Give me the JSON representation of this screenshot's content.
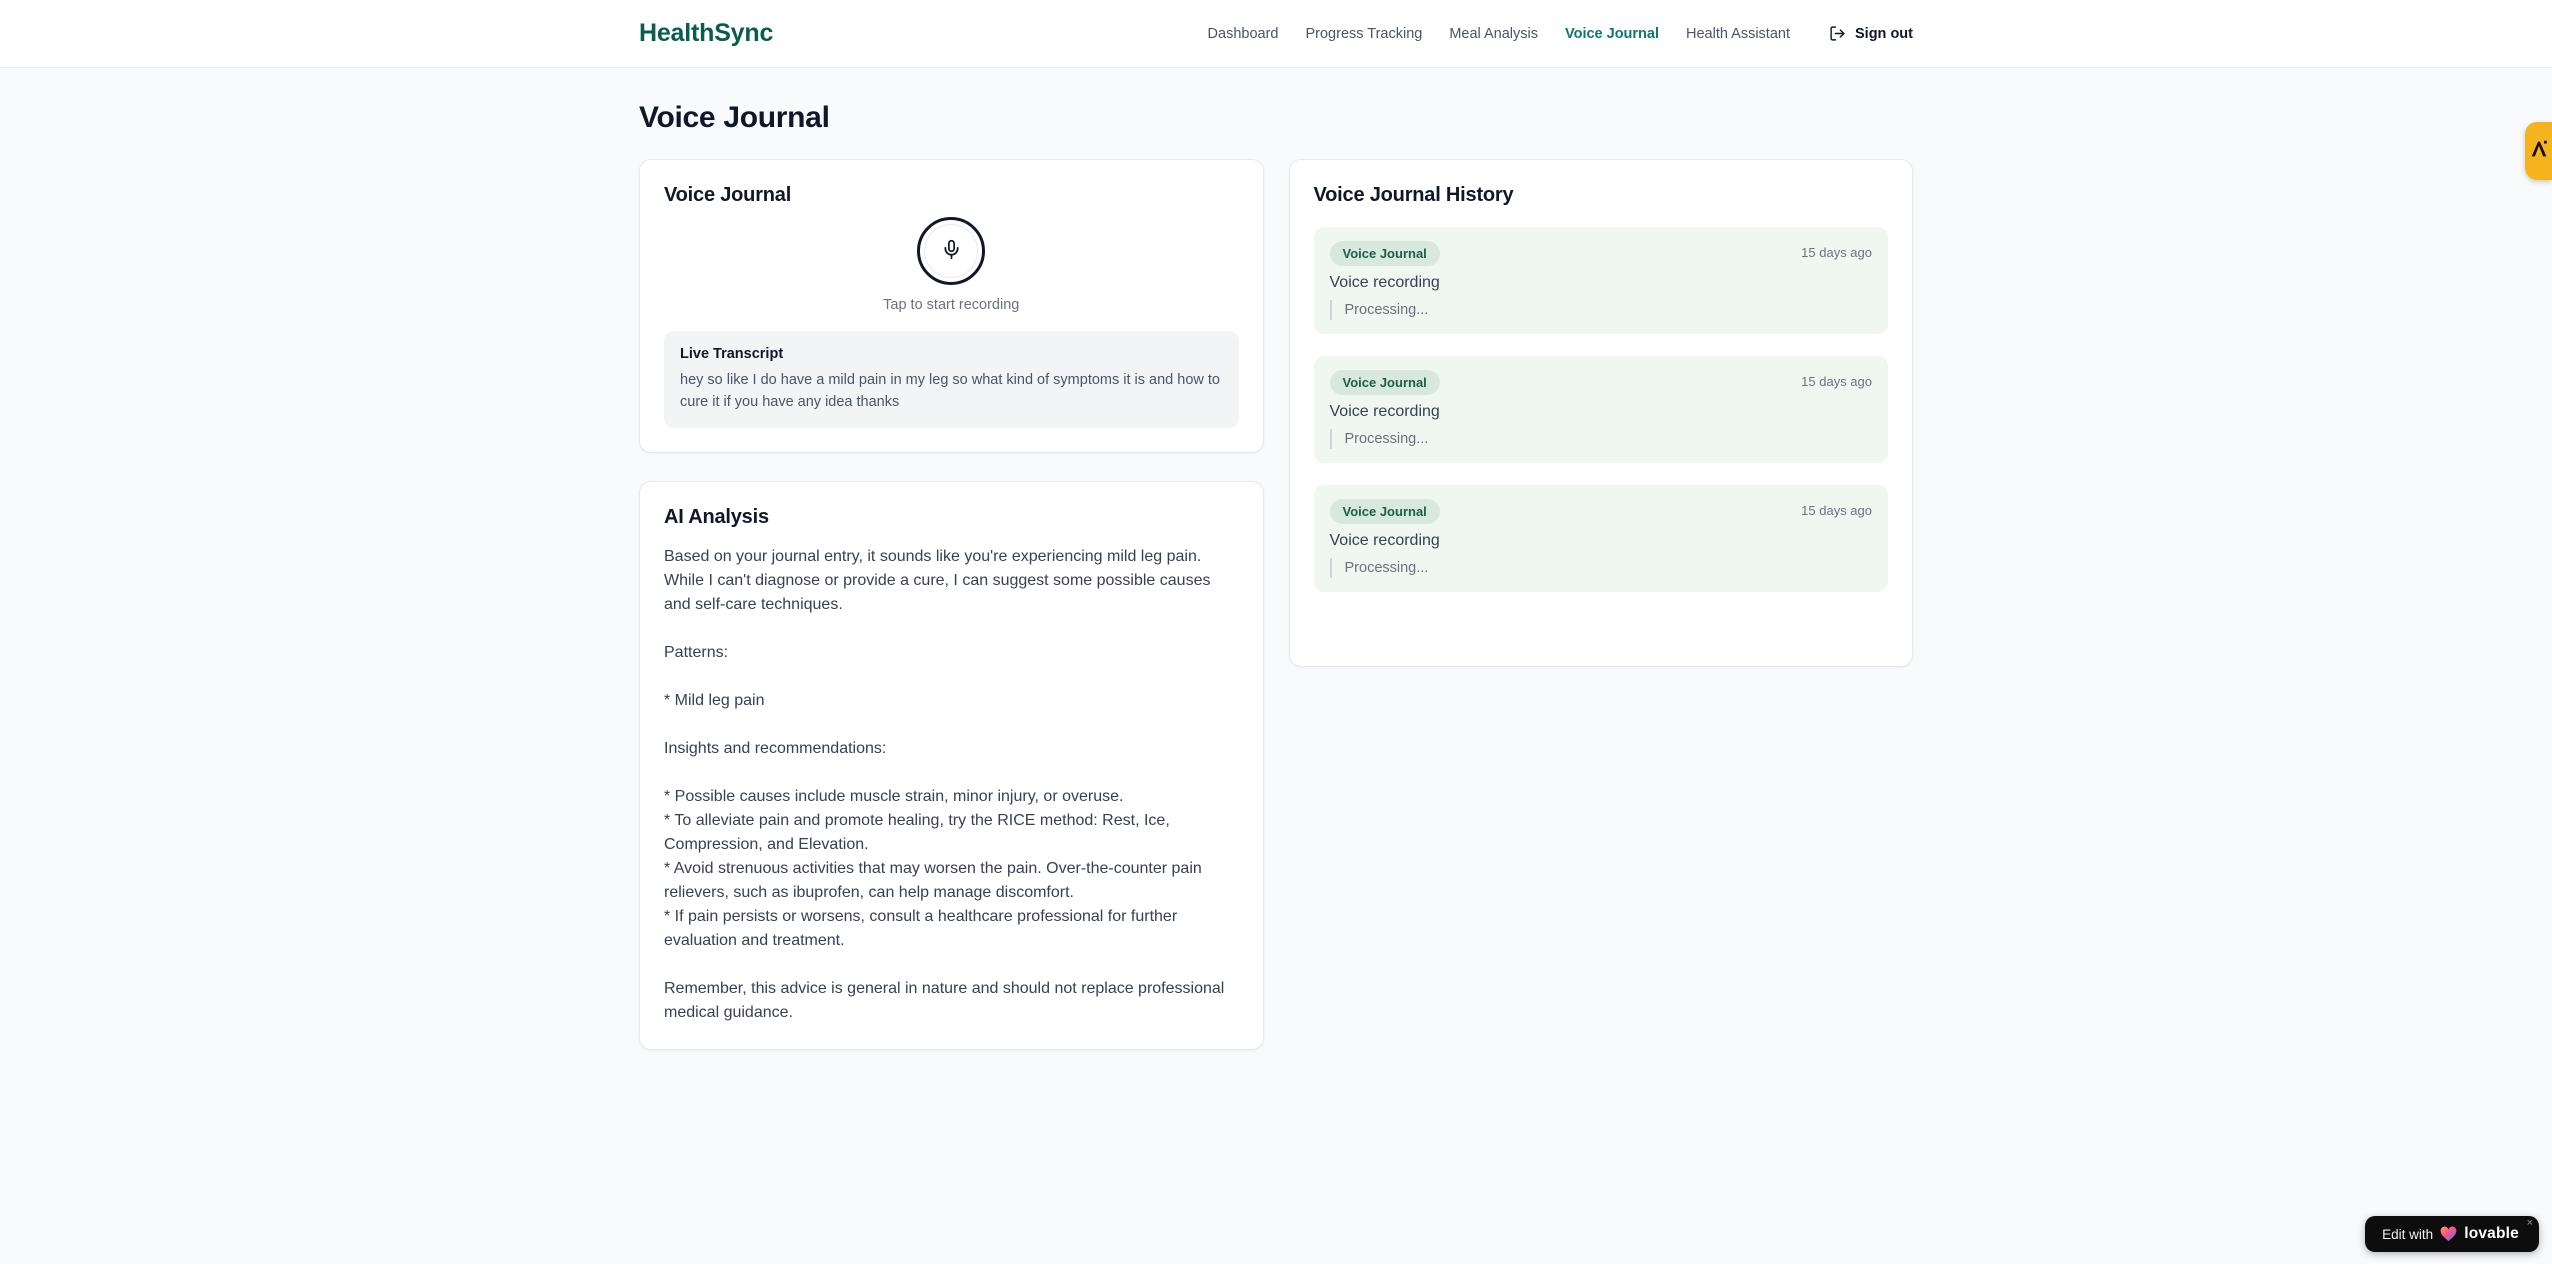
{
  "header": {
    "logo": "HealthSync",
    "nav": [
      {
        "label": "Dashboard",
        "active": false
      },
      {
        "label": "Progress Tracking",
        "active": false
      },
      {
        "label": "Meal Analysis",
        "active": false
      },
      {
        "label": "Voice Journal",
        "active": true
      },
      {
        "label": "Health Assistant",
        "active": false
      }
    ],
    "sign_out_label": "Sign out"
  },
  "page": {
    "title": "Voice Journal"
  },
  "recorder_card": {
    "title": "Voice Journal",
    "tap_hint": "Tap to start recording",
    "live_transcript": {
      "title": "Live Transcript",
      "text": "hey so like I do have a mild pain in my leg so what kind of symptoms it is and how to cure it if you have any idea thanks"
    }
  },
  "ai_analysis_card": {
    "title": "AI Analysis",
    "body": "Based on your journal entry, it sounds like you're experiencing mild leg pain. While I can't diagnose or provide a cure, I can suggest some possible causes and self-care techniques.\n\nPatterns:\n\n* Mild leg pain\n\nInsights and recommendations:\n\n* Possible causes include muscle strain, minor injury, or overuse.\n* To alleviate pain and promote healing, try the RICE method: Rest, Ice, Compression, and Elevation.\n* Avoid strenuous activities that may worsen the pain. Over-the-counter pain relievers, such as ibuprofen, can help manage discomfort.\n* If pain persists or worsens, consult a healthcare professional for further evaluation and treatment.\n\nRemember, this advice is general in nature and should not replace professional medical guidance."
  },
  "history_card": {
    "title": "Voice Journal History",
    "entries": [
      {
        "badge": "Voice Journal",
        "time": "15 days ago",
        "title": "Voice recording",
        "status": "Processing..."
      },
      {
        "badge": "Voice Journal",
        "time": "15 days ago",
        "title": "Voice recording",
        "status": "Processing..."
      },
      {
        "badge": "Voice Journal",
        "time": "15 days ago",
        "title": "Voice recording",
        "status": "Processing..."
      }
    ]
  },
  "widgets": {
    "lovable_badge": {
      "prefix": "Edit with",
      "brand": "lovable",
      "close": "×"
    }
  },
  "colors": {
    "accent_teal": "#0f766e",
    "logo_teal": "#0a5c4e",
    "badge_bg": "#d9e8dc",
    "badge_text": "#1b5e4a",
    "entry_bg": "#f0f7f0",
    "side_tab_amber": "#f5b41e",
    "page_bg": "#f8fafc"
  }
}
